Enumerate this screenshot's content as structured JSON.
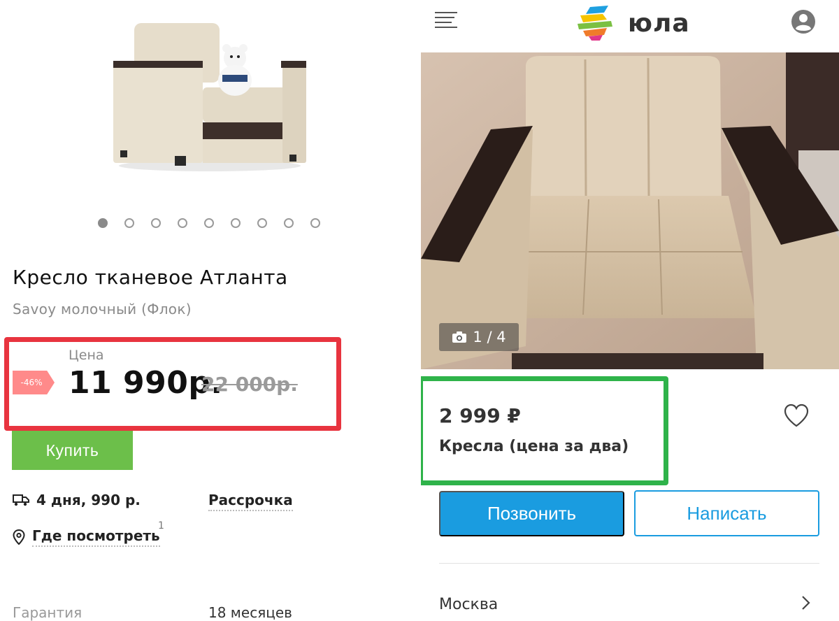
{
  "left": {
    "product_title": "Кресло тканевое Атланта",
    "product_subtitle": "Savoy молочный (Флок)",
    "price_label": "Цена",
    "discount": "-46%",
    "price": "11 990р.",
    "old_price": "22 000р.",
    "buy_label": "Купить",
    "delivery": "4 дня, 990 р.",
    "installment": "Рассрочка",
    "where_to_see": "Где посмотреть",
    "where_count": "1",
    "warranty_label": "Гарантия",
    "warranty_value": "18 месяцев",
    "gallery": {
      "count": 9,
      "active_index": 0
    },
    "colors": {
      "highlight": "#e8343f",
      "buy": "#6cbf4a",
      "discount": "#ff8a8a"
    }
  },
  "right": {
    "logo_text": "юла",
    "photo_counter": "1 / 4",
    "price": "2 999 ₽",
    "title": "Кресла (цена за два)",
    "call_label": "Позвонить",
    "write_label": "Написать",
    "city": "Москва",
    "icons": [
      "menu-icon",
      "profile-icon",
      "camera-icon",
      "heart-icon",
      "chevron-right-icon"
    ],
    "colors": {
      "highlight": "#2fb34a",
      "primary": "#1a9ce0"
    }
  }
}
